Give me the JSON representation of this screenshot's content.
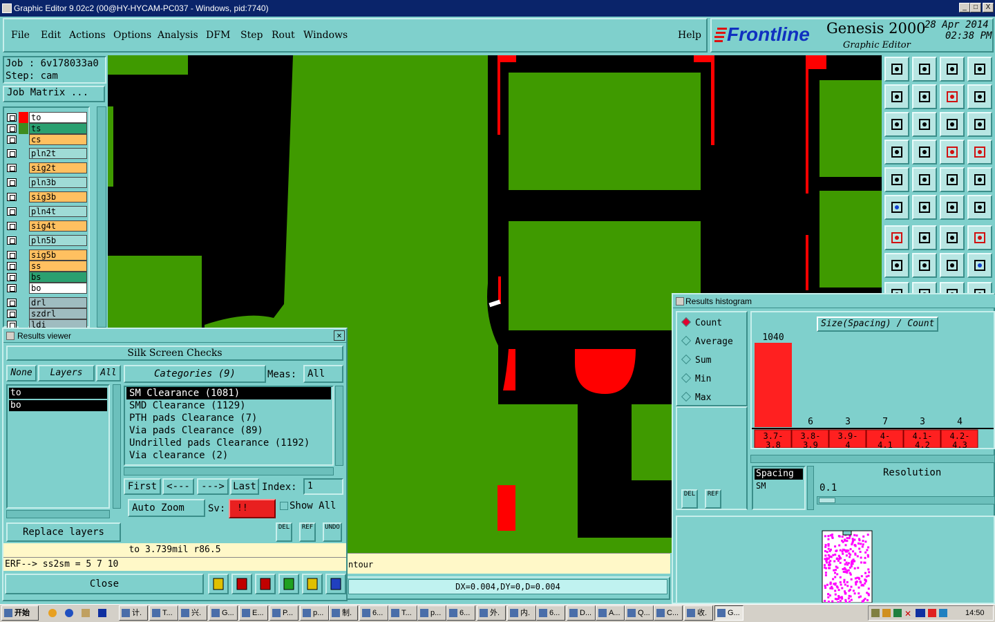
{
  "window": {
    "title": "Graphic Editor 9.02c2 (00@HY-HYCAM-PC037 - Windows, pid:7740)",
    "btn_min": "_",
    "btn_max": "□",
    "btn_close": "X"
  },
  "menu": {
    "file": "File",
    "edit": "Edit",
    "actions": "Actions",
    "options": "Options",
    "analysis": "Analysis",
    "dfm": "DFM",
    "step": "Step",
    "rout": "Rout",
    "windows": "Windows",
    "help": "Help"
  },
  "brand": {
    "logo": "Frontline",
    "product": "Genesis 2000",
    "subtitle": "Graphic Editor",
    "date": "28 Apr 2014",
    "time": "02:38 PM"
  },
  "job": {
    "job_line": "Job : 6v178033a0",
    "step_line": "Step: cam",
    "matrix_btn": "Job Matrix ..."
  },
  "layers": [
    {
      "name": "to",
      "color": "#ffffff",
      "swatch": "#ff0000"
    },
    {
      "name": "ts",
      "color": "#2aa070",
      "swatch": "#3d8c1f"
    },
    {
      "name": "cs",
      "color": "#ffc060",
      "swatch": "#7fd0cc"
    },
    {
      "name": "pln2t",
      "color": "#9fdbd6",
      "swatch": "#7fd0cc"
    },
    {
      "name": "sig2t",
      "color": "#ffc060",
      "swatch": "#7fd0cc"
    },
    {
      "name": "pln3b",
      "color": "#9fdbd6",
      "swatch": "#7fd0cc"
    },
    {
      "name": "sig3b",
      "color": "#ffc060",
      "swatch": "#7fd0cc"
    },
    {
      "name": "pln4t",
      "color": "#9fdbd6",
      "swatch": "#7fd0cc"
    },
    {
      "name": "sig4t",
      "color": "#ffc060",
      "swatch": "#7fd0cc"
    },
    {
      "name": "pln5b",
      "color": "#9fdbd6",
      "swatch": "#7fd0cc"
    },
    {
      "name": "sig5b",
      "color": "#ffc060",
      "swatch": "#7fd0cc"
    },
    {
      "name": "ss",
      "color": "#ffc060",
      "swatch": "#7fd0cc"
    },
    {
      "name": "bs",
      "color": "#2aa070",
      "swatch": "#7fd0cc"
    },
    {
      "name": "bo",
      "color": "#ffffff",
      "swatch": "#7fd0cc"
    },
    {
      "name": "drl",
      "color": "#9fbcc0",
      "swatch": "#7fd0cc"
    },
    {
      "name": "szdrl",
      "color": "#9fbcc0",
      "swatch": "#7fd0cc"
    },
    {
      "name": "ldi",
      "color": "#9fbcc0",
      "swatch": "#7fd0cc"
    }
  ],
  "results_viewer": {
    "title": "Results viewer",
    "header": "Silk Screen Checks",
    "none_btn": "None",
    "layers_label": "Layers",
    "all_btn": "All",
    "categories_btn": "Categories (9)",
    "meas_label": "Meas:",
    "meas_value": "All",
    "layer_items": [
      "to",
      "bo"
    ],
    "categories": [
      "SM Clearance (1081)",
      "SMD Clearance (1129)",
      "PTH pads Clearance (7)",
      "Via pads Clearance (89)",
      "Undrilled pads Clearance (1192)",
      "Via clearance (2)"
    ],
    "first": "First",
    "prev": "<---",
    "next": "--->",
    "last": "Last",
    "index_label": "Index:",
    "index_value": "1",
    "auto_zoom": "Auto Zoom",
    "sv_label": "Sv:",
    "sv_value": "!!",
    "show_all": "Show All",
    "replace_layers": "Replace layers",
    "del": "DEL",
    "ref": "REF",
    "undo": "UNDO",
    "status": "to 3.739mil  r86.5",
    "erf": "ERF--> ss2sm = 5 7 10",
    "close": "Close"
  },
  "histogram": {
    "title": "Results histogram",
    "heading": "Size(Spacing) / Count",
    "modes": [
      {
        "label": "Count",
        "on": true
      },
      {
        "label": "Average",
        "on": false
      },
      {
        "label": "Sum",
        "on": false
      },
      {
        "label": "Min",
        "on": false
      },
      {
        "label": "Max",
        "on": false
      }
    ],
    "del": "DEL",
    "ref": "REF",
    "spacing_hdr": "Spacing",
    "spacing_val": "SM",
    "resolution_label": "Resolution",
    "resolution_value": "0.1"
  },
  "chart_data": {
    "type": "bar",
    "title": "Size(Spacing) / Count",
    "categories": [
      "3.7-3.8",
      "3.8-3.9",
      "3.9-4",
      "4-4.1",
      "4.1-4.2",
      "4.2-4.3"
    ],
    "values": [
      1040,
      6,
      3,
      7,
      3,
      4
    ]
  },
  "canvas": {
    "contour_text": "ntour",
    "coords": "DX=0.004,DY=0,D=0.004"
  },
  "taskbar": {
    "start": "开始",
    "clock": "14:50",
    "items": [
      "计.",
      "T...",
      "兴.",
      "G...",
      "E...",
      "P...",
      "p...",
      "制.",
      "6...",
      "T...",
      "p...",
      "6...",
      "外.",
      "内.",
      "6...",
      "D...",
      "A...",
      "Q...",
      "C...",
      "收.",
      "G..."
    ]
  }
}
